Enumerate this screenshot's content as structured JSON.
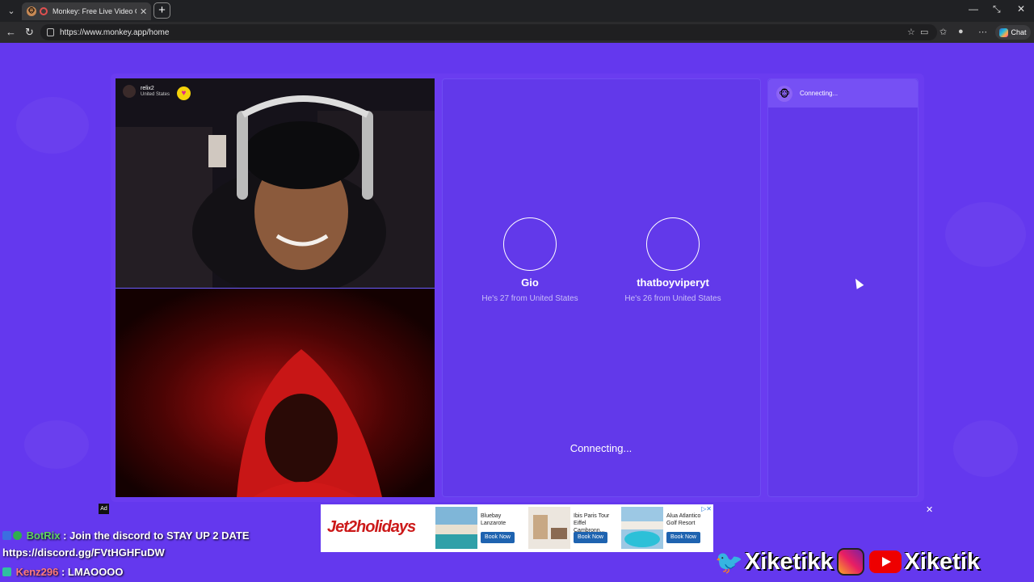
{
  "browser": {
    "tab_title": "Monkey: Free Live Video Chat",
    "url": "https://www.monkey.app/home",
    "chat_label": "Chat"
  },
  "top_video": {
    "username": "relix2",
    "country": "United States"
  },
  "match": {
    "people": [
      {
        "name": "Gio",
        "info": "He's 27 from United States"
      },
      {
        "name": "thatboyviperyt",
        "info": "He's 26 from United States"
      }
    ],
    "status": "Connecting..."
  },
  "side_panel": {
    "status": "Connecting..."
  },
  "ad": {
    "label": "Ad",
    "brand": "Jet2holidays",
    "cards": [
      {
        "name": "Bluebay Lanzarote",
        "button": "Book Now"
      },
      {
        "name": "Ibis Paris Tour Eiffel Cambronn...",
        "button": "Book Now"
      },
      {
        "name": "Alua Atlantico Golf Resort",
        "button": "Book Now"
      }
    ]
  },
  "chat_overlay": [
    {
      "user": "BotRix",
      "message": " : Join the discord to STAY UP 2 DATE"
    },
    {
      "user": "",
      "message": "https://discord.gg/FVtHGHFuDW"
    },
    {
      "user": "Kenz296",
      "message": " : LMAOOOO"
    }
  ],
  "socials": {
    "twitter_handle": "Xiketikk",
    "youtube_handle": "Xiketik"
  },
  "colors": {
    "page_bg": "#6438ee",
    "panel_bg": "#6239ea",
    "accent_heart": "#f5d20a"
  }
}
